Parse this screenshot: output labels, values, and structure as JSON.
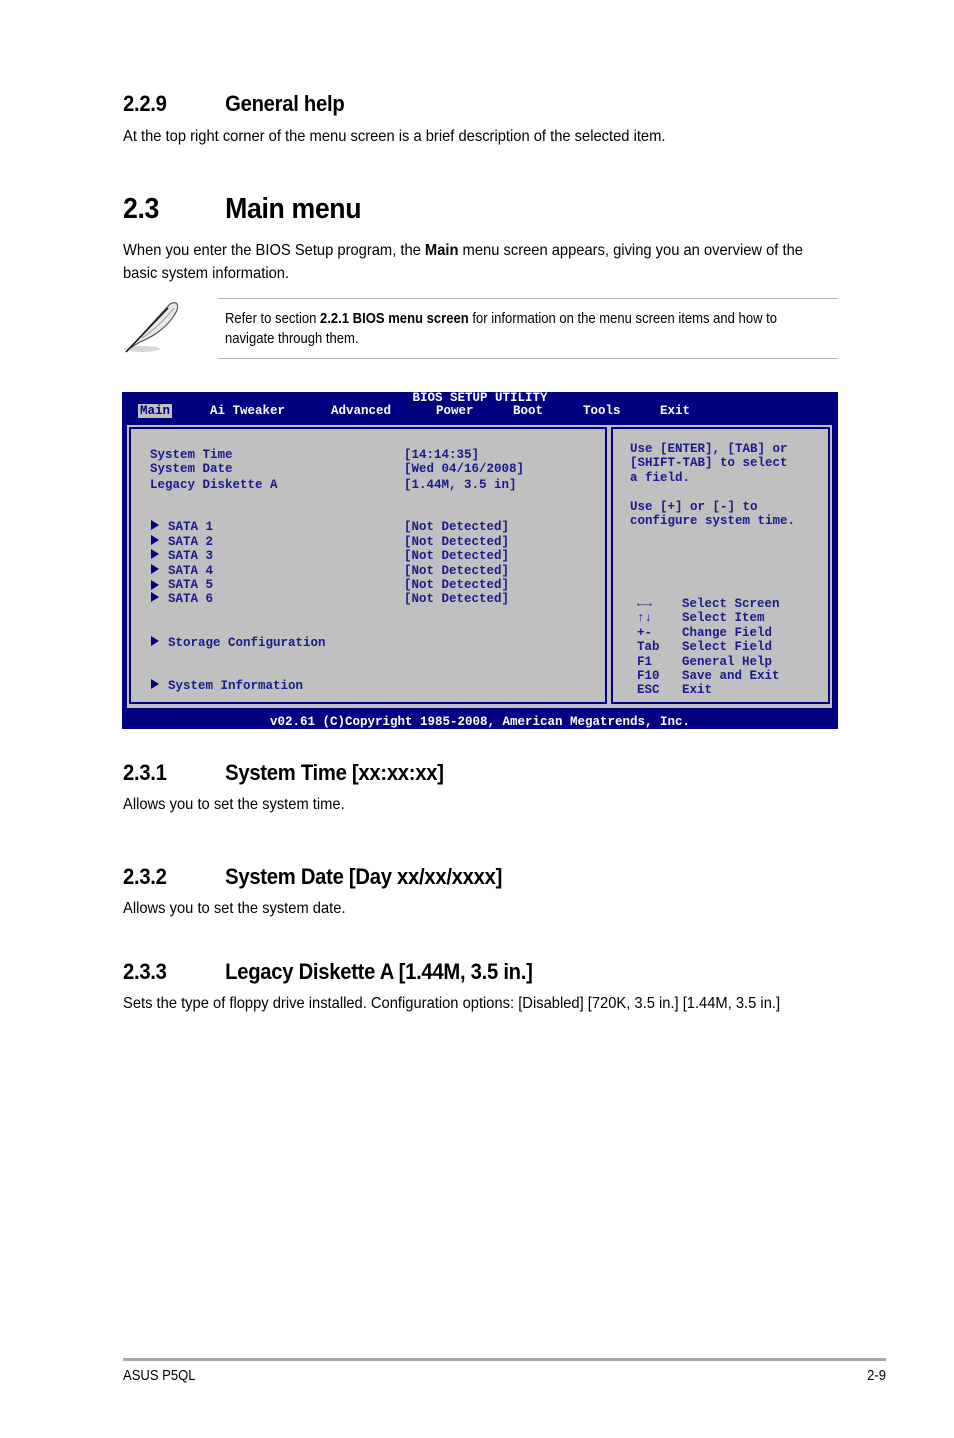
{
  "section_229": {
    "number": "2.2.9",
    "title": "General help",
    "body": "At the top right corner of the menu screen is a brief description of the selected item."
  },
  "section_23": {
    "number": "2.3",
    "title": "Main menu",
    "body_prefix": "When you enter the BIOS Setup program, the ",
    "body_bold": "Main",
    "body_suffix": " menu screen appears, giving you an overview of the basic system information."
  },
  "note": {
    "icon": "feather-pen-icon",
    "prefix": "Refer to section ",
    "bold": "2.2.1 BIOS menu screen",
    "suffix": " for information on the menu screen items and how to navigate through them."
  },
  "bios": {
    "title": "BIOS SETUP UTILITY",
    "tabs": [
      {
        "label": "Main",
        "active": true
      },
      {
        "label": "Ai Tweaker",
        "active": false
      },
      {
        "label": "Advanced",
        "active": false
      },
      {
        "label": "Power",
        "active": false
      },
      {
        "label": "Boot",
        "active": false
      },
      {
        "label": "Tools",
        "active": false
      },
      {
        "label": "Exit",
        "active": false
      }
    ],
    "settings": [
      {
        "label": "System Time",
        "value": "[14:14:35]"
      },
      {
        "label": "System Date",
        "value": "[Wed 04/16/2008]"
      },
      {
        "label": "Legacy Diskette A",
        "value": "[1.44M, 3.5 in]"
      }
    ],
    "sata": [
      {
        "label": "SATA 1",
        "value": "[Not Detected]"
      },
      {
        "label": "SATA 2",
        "value": "[Not Detected]"
      },
      {
        "label": "SATA 3",
        "value": "[Not Detected]"
      },
      {
        "label": "SATA 4",
        "value": "[Not Detected]"
      },
      {
        "label": "SATA 5",
        "value": "[Not Detected]"
      },
      {
        "label": "SATA 6",
        "value": "[Not Detected]"
      }
    ],
    "submenus": [
      {
        "label": "Storage Configuration"
      },
      {
        "label": "System Information"
      }
    ],
    "help_lines": [
      "Use [ENTER], [TAB] or",
      "[SHIFT-TAB] to select",
      "a field.",
      "",
      "Use [+] or [-] to",
      "configure system time."
    ],
    "keys": [
      {
        "key": "←→",
        "action": "Select Screen"
      },
      {
        "key": "↑↓",
        "action": "Select Item"
      },
      {
        "key": "+-",
        "action": "Change Field"
      },
      {
        "key": "Tab",
        "action": "Select Field"
      },
      {
        "key": "F1",
        "action": "General Help"
      },
      {
        "key": "F10",
        "action": "Save and Exit"
      },
      {
        "key": "ESC",
        "action": "Exit"
      }
    ],
    "footer": "v02.61 (C)Copyright 1985-2008, American Megatrends, Inc.",
    "colors": {
      "frame": "#000080",
      "panel": "#c0c0c0",
      "text": "#1a1a8c"
    }
  },
  "section_231": {
    "number": "2.3.1",
    "title": "System Time [xx:xx:xx]",
    "body": "Allows you to set the system time."
  },
  "section_232": {
    "number": "2.3.2",
    "title": "System Date [Day xx/xx/xxxx]",
    "body": "Allows you to set the system date."
  },
  "section_233": {
    "number": "2.3.3",
    "title": "Legacy Diskette A [1.44M, 3.5 in.]",
    "body": "Sets the type of floppy drive installed. Configuration options: [Disabled] [720K, 3.5 in.] [1.44M, 3.5 in.]"
  },
  "footer": {
    "product": "ASUS P5QL",
    "page": "2-9"
  }
}
